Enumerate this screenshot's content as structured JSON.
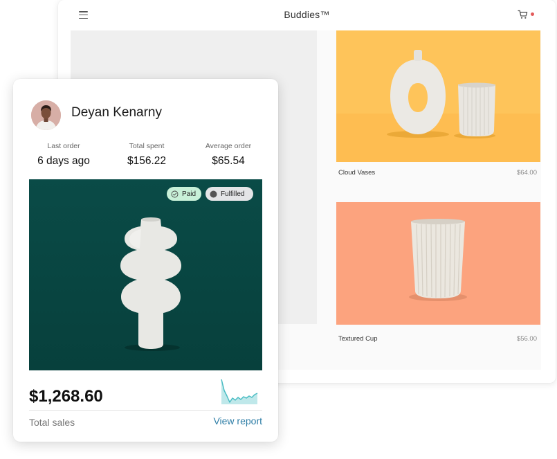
{
  "store": {
    "title": "Buddies™",
    "cart_notification_color": "#e35b5b",
    "products": [
      {
        "name": "Cloud Vases",
        "price": "$64.00",
        "background": "#fec45a"
      },
      {
        "name": "Textured Cup",
        "price": "$56.00",
        "background": "#fca37e"
      }
    ]
  },
  "customer": {
    "name": "Deyan Kenarny",
    "stats": [
      {
        "label": "Last order",
        "value": "6 days ago"
      },
      {
        "label": "Total spent",
        "value": "$156.22"
      },
      {
        "label": "Average order",
        "value": "$65.54"
      }
    ],
    "badges": {
      "paid": "Paid",
      "fulfilled": "Fulfilled"
    },
    "hero_background": "#0a4a47"
  },
  "sales": {
    "total_value": "$1,268.60",
    "total_label": "Total sales",
    "view_report": "View report",
    "link_color": "#2d7da6",
    "sparkline_color": "#49bcc3"
  },
  "icons": {
    "menu": "hamburger-icon",
    "cart": "cart-icon",
    "paid": "check-circle-icon",
    "fulfilled": "circle-icon"
  }
}
